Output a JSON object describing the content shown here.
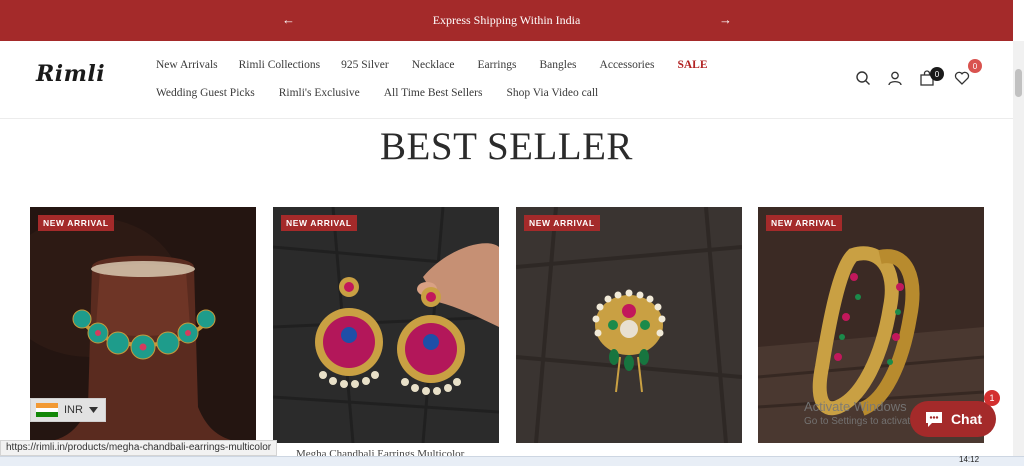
{
  "announcement": {
    "text": "Express Shipping Within India",
    "prev_arrow": "←",
    "next_arrow": "→"
  },
  "logo": {
    "text": "Rimli"
  },
  "nav": {
    "row1": [
      "New Arrivals",
      "Rimli Collections",
      "925 Silver",
      "Necklace",
      "Earrings",
      "Bangles",
      "Accessories",
      "SALE"
    ],
    "row2": [
      "Wedding Guest Picks",
      "Rimli's Exclusive",
      "All Time Best Sellers",
      "Shop Via Video call"
    ]
  },
  "header_icons": {
    "cart_count": "0",
    "wishlist_count": "0"
  },
  "section": {
    "title": "BEST SELLER"
  },
  "products": [
    {
      "tag": "NEW ARRIVAL",
      "title": ""
    },
    {
      "tag": "NEW ARRIVAL",
      "title": "Megha Chandbali Earrings Multicolor"
    },
    {
      "tag": "NEW ARRIVAL",
      "title": ""
    },
    {
      "tag": "NEW ARRIVAL",
      "title": ""
    }
  ],
  "currency": {
    "code": "INR"
  },
  "status_url": "https://rimli.in/products/megha-chandbali-earrings-multicolor",
  "chat": {
    "label": "Chat",
    "badge": "1"
  },
  "windows_notice": {
    "line1": "Activate Windows",
    "line2": "Go to Settings to activate Windows."
  },
  "taskbar": {
    "time": "14:12"
  },
  "colors": {
    "brand": "#a42a2a",
    "sale": "#b22222"
  }
}
